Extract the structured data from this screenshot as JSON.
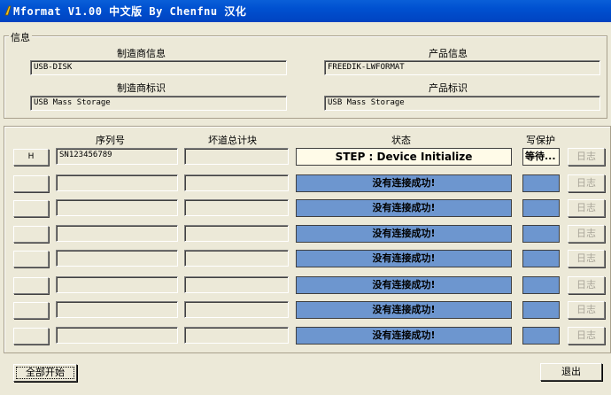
{
  "window": {
    "title": "Mformat V1.00 中文版 By Chenfnu 汉化"
  },
  "info": {
    "legend": "信息",
    "manufacturer_info_label": "制造商信息",
    "manufacturer_info_value": "USB-DISK",
    "product_info_label": "产品信息",
    "product_info_value": "FREEDIK-LWFORMAT",
    "manufacturer_id_label": "制造商标识",
    "manufacturer_id_value": "USB Mass Storage",
    "product_id_label": "产品标识",
    "product_id_value": "USB Mass Storage"
  },
  "columns": {
    "serial": "序列号",
    "badblocks": "坏道总计块",
    "status": "状态",
    "writeprotect": "写保护"
  },
  "rows": [
    {
      "btn": "H",
      "serial": "SN123456789",
      "badblocks": "",
      "status": "STEP : Device Initialize",
      "wp": "等待...",
      "log": "日志"
    },
    {
      "btn": "",
      "serial": "",
      "badblocks": "",
      "status": "没有连接成功!",
      "wp": "",
      "log": "日志"
    },
    {
      "btn": "",
      "serial": "",
      "badblocks": "",
      "status": "没有连接成功!",
      "wp": "",
      "log": "日志"
    },
    {
      "btn": "",
      "serial": "",
      "badblocks": "",
      "status": "没有连接成功!",
      "wp": "",
      "log": "日志"
    },
    {
      "btn": "",
      "serial": "",
      "badblocks": "",
      "status": "没有连接成功!",
      "wp": "",
      "log": "日志"
    },
    {
      "btn": "",
      "serial": "",
      "badblocks": "",
      "status": "没有连接成功!",
      "wp": "",
      "log": "日志"
    },
    {
      "btn": "",
      "serial": "",
      "badblocks": "",
      "status": "没有连接成功!",
      "wp": "",
      "log": "日志"
    },
    {
      "btn": "",
      "serial": "",
      "badblocks": "",
      "status": "没有连接成功!",
      "wp": "",
      "log": "日志"
    }
  ],
  "footer": {
    "start_all": "全部开始",
    "exit": "退出"
  }
}
